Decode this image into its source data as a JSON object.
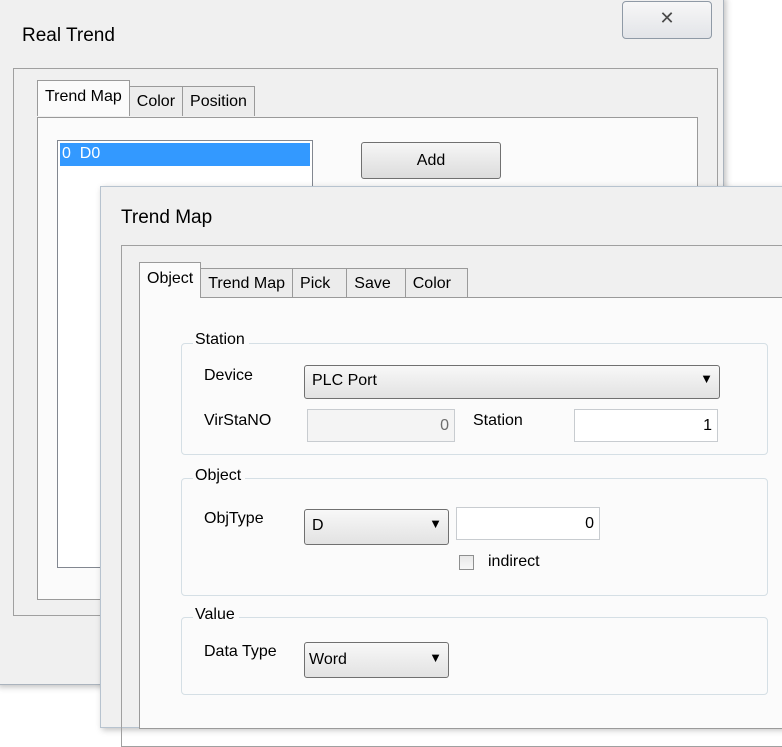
{
  "real_trend": {
    "title": "Real Trend",
    "close_glyph": "✕",
    "tabs": [
      {
        "label": "Trend Map"
      },
      {
        "label": "Color"
      },
      {
        "label": "Position"
      }
    ],
    "list_items": [
      "0  D0"
    ],
    "add_label": "Add",
    "selected_color": "#3399ff"
  },
  "trend_map": {
    "title": "Trend Map",
    "tabs": [
      {
        "label": "Object"
      },
      {
        "label": "Trend Map"
      },
      {
        "label": "Pick"
      },
      {
        "label": "Save"
      },
      {
        "label": "Color"
      }
    ],
    "station": {
      "legend": "Station",
      "device_label": "Device",
      "device_value": "PLC Port",
      "virstano_label": "VirStaNO",
      "virstano_value": "0",
      "station_label": "Station",
      "station_value": "1"
    },
    "object": {
      "legend": "Object",
      "objtype_label": "ObjType",
      "objtype_value": "D",
      "address_value": "0",
      "indirect_label": "indirect"
    },
    "value": {
      "legend": "Value",
      "datatype_label": "Data Type",
      "datatype_value": "Word"
    }
  }
}
